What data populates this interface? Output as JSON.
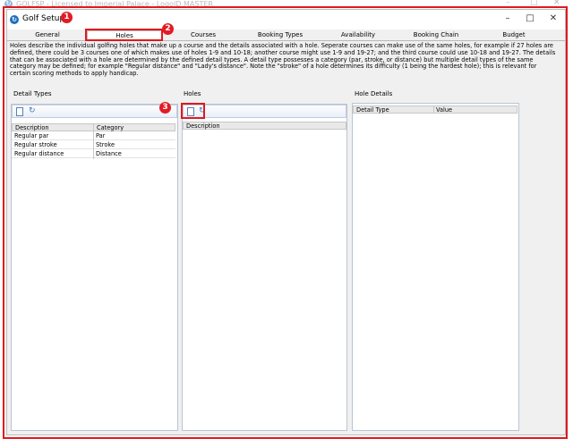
{
  "behind_window": {
    "title": "GOLFSP - Licensed to Imperial Palace - LogoID MASTER",
    "controls": [
      "–",
      "□",
      "✕"
    ]
  },
  "window": {
    "title": "Golf Setup",
    "controls": {
      "minimize": "–",
      "maximize": "□",
      "close": "✕"
    }
  },
  "annotations": {
    "badge1": "1",
    "badge2": "2",
    "badge3": "3"
  },
  "tabs": [
    "General",
    "Holes",
    "Courses",
    "Booking Types",
    "Availability",
    "Booking Chain",
    "Budget"
  ],
  "active_tab": "Holes",
  "description": "Holes describe the individual golfing holes that make up a course and the details associated with a hole. Seperate courses can make use of the same holes, for example if 27 holes are defined, there could be 3 courses one of which makes use of holes 1-9 and 10-18; another course might use 1-9 and 19-27; and the third course could use 10-18 and 19-27. The details that can be associated with a hole are determined by the defined detail types. A detail type possesses a category (par, stroke, or distance) but multiple detail types of the same category may be defined; for example \"Regular distance\" and \"Lady's distance\". Note the \"stroke\" of a hole determines its difficulty (1 being the hardest hole); this is relevant for certain scoring methods to apply handicap.",
  "detail_types": {
    "label": "Detail Types",
    "columns": [
      "Description",
      "Category"
    ],
    "rows": [
      [
        "Regular par",
        "Par"
      ],
      [
        "Regular stroke",
        "Stroke"
      ],
      [
        "Regular distance",
        "Distance"
      ]
    ]
  },
  "holes": {
    "label": "Holes",
    "columns": [
      "Description"
    ]
  },
  "hole_details": {
    "label": "Hole Details",
    "columns": [
      "Detail Type",
      "Value"
    ]
  },
  "icons": {
    "new": "new-document-icon",
    "refresh": "refresh-icon"
  },
  "colors": {
    "annotation_red": "#e0191f",
    "app_icon_blue": "#1f6fbf"
  }
}
